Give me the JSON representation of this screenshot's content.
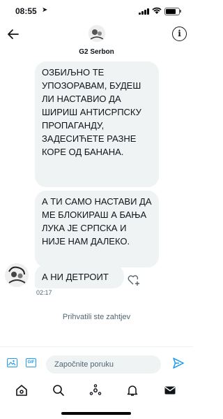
{
  "status_bar": {
    "time": "08:55",
    "battery_level": 0.75
  },
  "header": {
    "title": "G2 Serbon"
  },
  "messages": [
    {
      "text": "ОЗБИЉНО ТЕ УПОЗОРАВАМ, БУДЕШ ЛИ НАСТАВИО ДА ШИРИШ АНТИСРПСКУ ПРОПАГАНДУ, ЗАДЕСИЋЕТЕ РАЗНЕ КОРЕ ОД БАНАНА."
    },
    {
      "text": "А ТИ САМО НАСТАВИ ДА МЕ БЛОКИРАШ А БАЊА ЛУКА ЈЕ СРПСКА И НИЈЕ НАМ ДАЛЕКО."
    },
    {
      "text": "А НИ ДЕТРОИТ"
    }
  ],
  "last_message_time": "02:17",
  "system_note": "Prihvatili ste zahtjev",
  "composer": {
    "placeholder": "Započnite poruku",
    "gif_label": "GIF"
  },
  "colors": {
    "accent": "#1d9bf0",
    "bubble": "#eff3f4",
    "muted": "#536471"
  },
  "icons": {
    "back": "arrow-left-icon",
    "info": "info-icon",
    "image": "image-icon",
    "gif": "gif-icon",
    "send": "send-icon",
    "react": "heart-plus-icon",
    "tabs": [
      "home-icon",
      "search-icon",
      "spaces-icon",
      "notifications-icon",
      "messages-icon"
    ]
  }
}
